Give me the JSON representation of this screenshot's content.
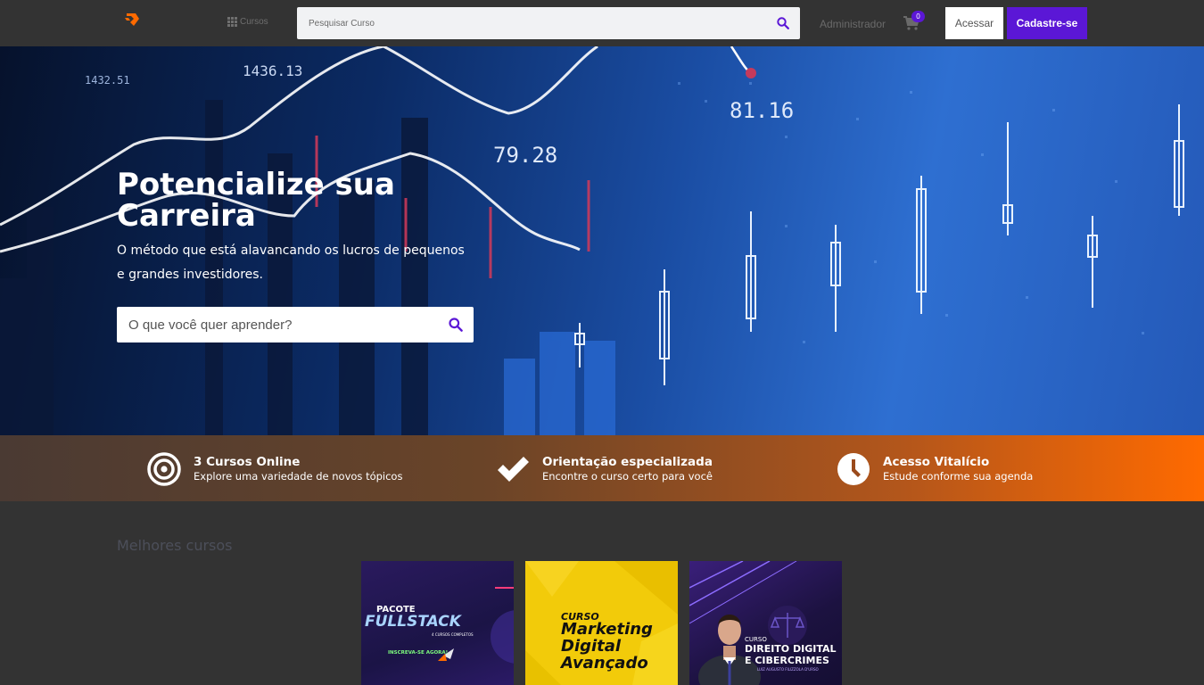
{
  "header": {
    "nav_courses": "Cursos",
    "search_placeholder": "Pesquisar Curso",
    "admin_label": "Administrador",
    "cart_count": "0",
    "login_label": "Acessar",
    "signup_label": "Cadastre-se"
  },
  "hero": {
    "title": "Potencialize sua Carreira",
    "subtitle": "O método que está alavancando os lucros de pequenos e grandes investidores.",
    "search_placeholder": "O que você quer aprender?"
  },
  "features": [
    {
      "title": "3 Cursos Online",
      "subtitle": "Explore uma variedade de novos tópicos",
      "icon": "target-icon"
    },
    {
      "title": "Orientação especializada",
      "subtitle": "Encontre o curso certo para você",
      "icon": "check-icon"
    },
    {
      "title": "Acesso Vitalício",
      "subtitle": "Estude conforme sua agenda",
      "icon": "clock-icon"
    }
  ],
  "courses_section": {
    "title": "Melhores cursos",
    "cards": [
      {
        "line1": "PACOTE",
        "line2": "FULLSTACK",
        "line3": "4 CURSOS COMPLETOS",
        "line4": "INSCREVA-SE AGORA!"
      },
      {
        "line1": "CURSO",
        "line2": "Marketing",
        "line3": "Digital",
        "line4": "Avançado"
      },
      {
        "line1": "CURSO",
        "line2": "DIREITO DIGITAL",
        "line3": "E CIBERCRIMES",
        "line4": "LUIZ AUGUSTO FILIZZOLA D'URSO"
      }
    ]
  },
  "colors": {
    "accent": "#5b17d6",
    "orange": "#ff6a00",
    "bg": "#333333"
  }
}
